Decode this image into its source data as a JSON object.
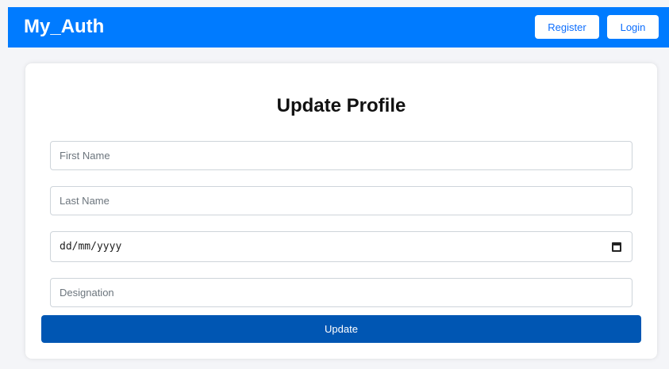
{
  "navbar": {
    "brand": "My_Auth",
    "register_label": "Register",
    "login_label": "Login"
  },
  "form": {
    "title": "Update Profile",
    "first_name_placeholder": "First Name",
    "last_name_placeholder": "Last Name",
    "date_placeholder": "dd/mm/yyyy",
    "designation_placeholder": "Designation",
    "submit_label": "Update"
  },
  "icons": {
    "date_picker": "calendar-icon"
  },
  "colors": {
    "navbar": "#007bff",
    "submit_button": "#0056b3"
  }
}
